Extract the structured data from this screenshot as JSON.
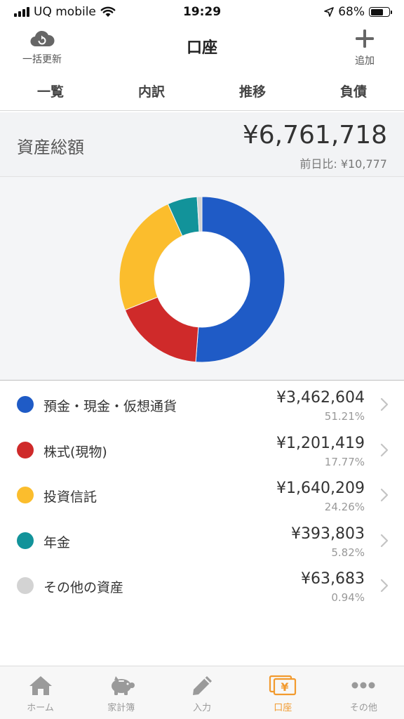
{
  "status": {
    "carrier": "UQ mobile",
    "time": "19:29",
    "battery": "68%",
    "battery_level": 0.68
  },
  "nav": {
    "title": "口座",
    "refresh_label": "一括更新",
    "add_label": "追加"
  },
  "tabs": [
    {
      "label": "一覧"
    },
    {
      "label": "内訳"
    },
    {
      "label": "推移"
    },
    {
      "label": "負債"
    }
  ],
  "active_tab": 1,
  "total": {
    "label": "資産総額",
    "value": "¥6,761,718",
    "diff": "前日比: ¥10,777"
  },
  "chart_data": {
    "type": "pie",
    "categories": [
      "預金・現金・仮想通貨",
      "株式(現物)",
      "投資信託",
      "年金",
      "その他の資産"
    ],
    "values": [
      51.21,
      17.77,
      24.26,
      5.82,
      0.94
    ],
    "colors": [
      "#1f5bc6",
      "#cf2a2a",
      "#fbbd2d",
      "#12939a",
      "#d3d3d3"
    ],
    "donut": true
  },
  "items": [
    {
      "label": "預金・現金・仮想通貨",
      "amount": "¥3,462,604",
      "pct": "51.21%",
      "color": "#1f5bc6"
    },
    {
      "label": "株式(現物)",
      "amount": "¥1,201,419",
      "pct": "17.77%",
      "color": "#cf2a2a"
    },
    {
      "label": "投資信託",
      "amount": "¥1,640,209",
      "pct": "24.26%",
      "color": "#fbbd2d"
    },
    {
      "label": "年金",
      "amount": "¥393,803",
      "pct": "5.82%",
      "color": "#12939a"
    },
    {
      "label": "その他の資産",
      "amount": "¥63,683",
      "pct": "0.94%",
      "color": "#d3d3d3"
    }
  ],
  "tabbar": [
    {
      "label": "ホーム",
      "icon": "home-icon"
    },
    {
      "label": "家計簿",
      "icon": "piggy-bank-icon"
    },
    {
      "label": "入力",
      "icon": "pencil-icon"
    },
    {
      "label": "口座",
      "icon": "yen-cards-icon"
    },
    {
      "label": "その他",
      "icon": "more-icon"
    }
  ],
  "active_tabbar": 3,
  "accent_color": "#f29a2e"
}
